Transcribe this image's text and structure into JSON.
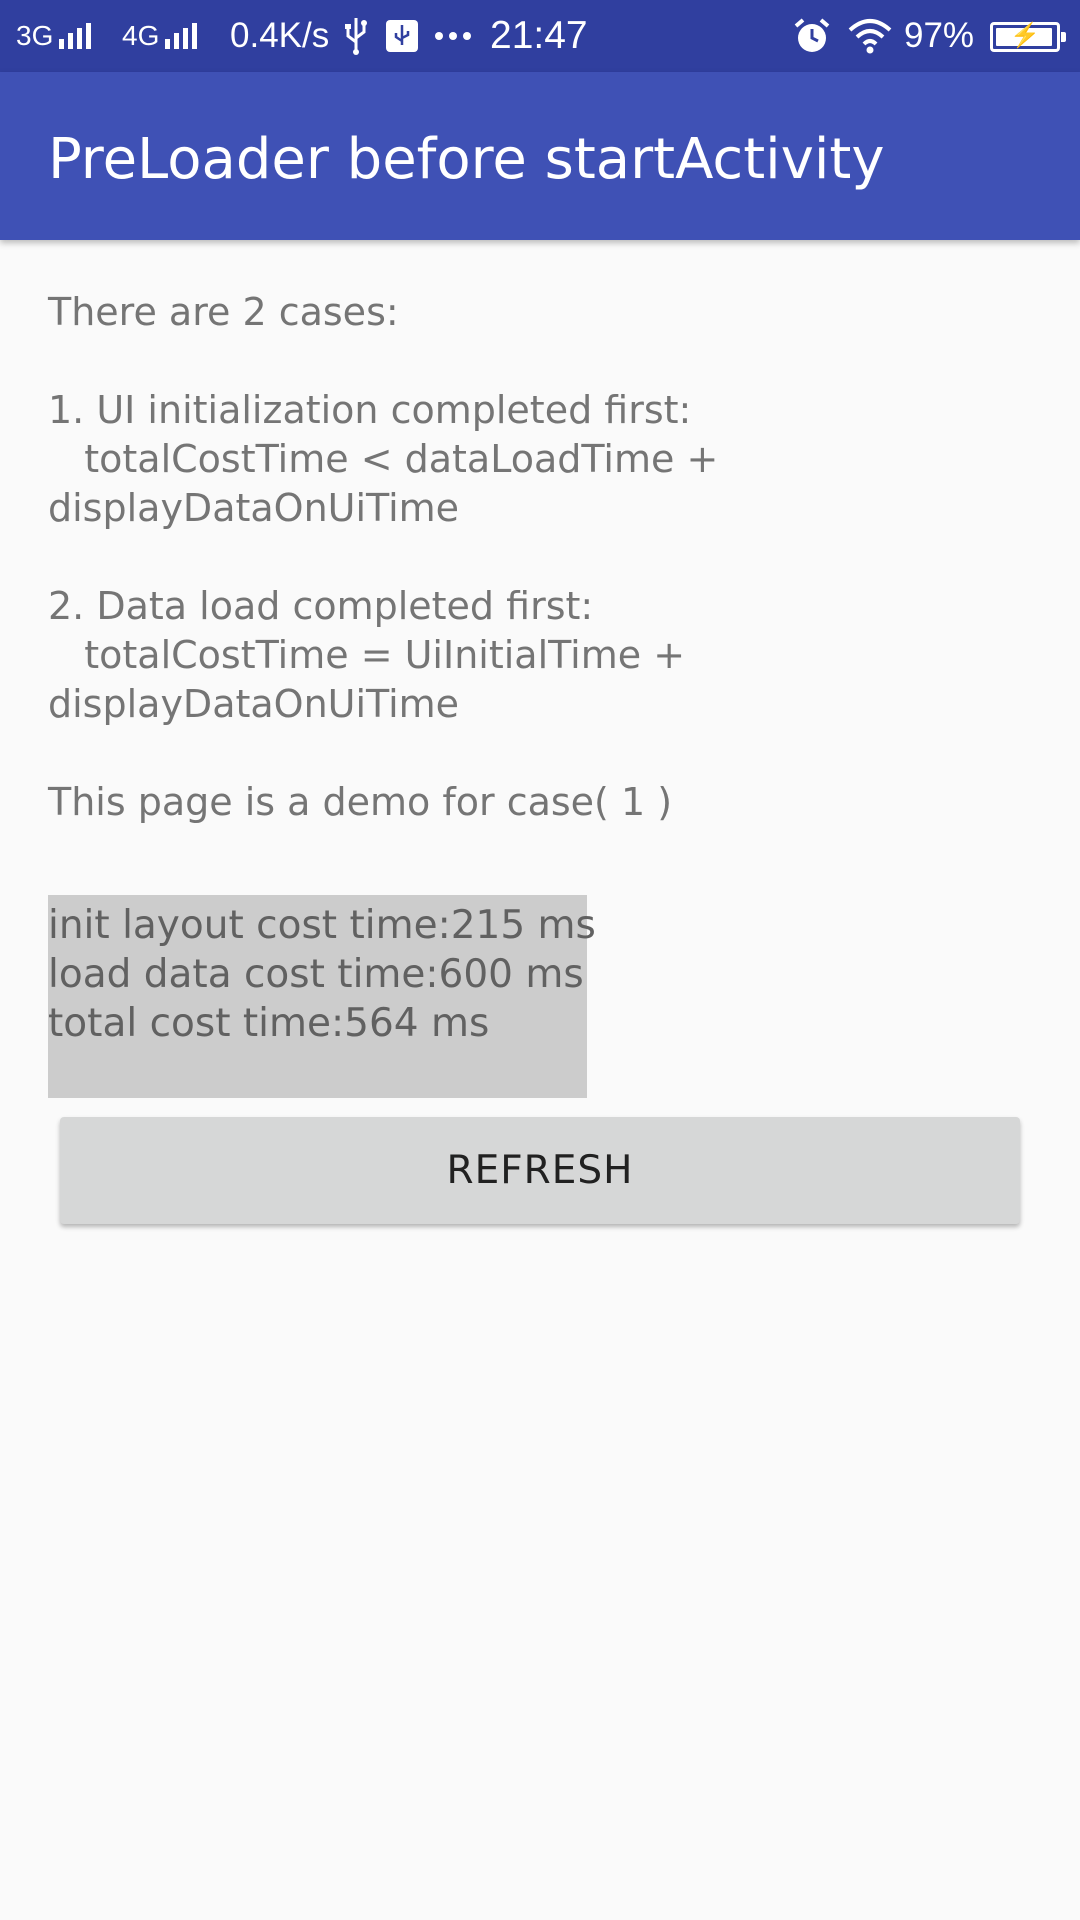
{
  "status_bar": {
    "network_1": "3G",
    "network_2": "4G",
    "speed": "0.4K/s",
    "time": "21:47",
    "battery": "97%",
    "battery_level": 0.97,
    "icons": [
      "signal-icon",
      "usb-icon",
      "usb-debug-icon",
      "more-icon",
      "alarm-icon",
      "wifi-icon",
      "battery-icon"
    ]
  },
  "toolbar": {
    "title": "PreLoader before startActivity"
  },
  "content": {
    "description": "There are 2 cases:\n\n1. UI initialization completed first:\n   totalCostTime < dataLoadTime +\ndisplayDataOnUiTime\n\n2. Data load completed first:\n   totalCostTime = UiInitialTime +\ndisplayDataOnUiTime\n\nThis page is a demo for case( 1 )",
    "timings": {
      "init_layout": "init layout cost time:215 ms",
      "load_data": "load data cost time:600 ms",
      "total": "total cost time:564 ms"
    },
    "refresh_label": "REFRESH"
  },
  "colors": {
    "status_bar": "#303f9f",
    "toolbar": "#3f51b5",
    "background": "#fafafa",
    "timings_background": "#cccccc",
    "button": "#d6d7d7"
  }
}
